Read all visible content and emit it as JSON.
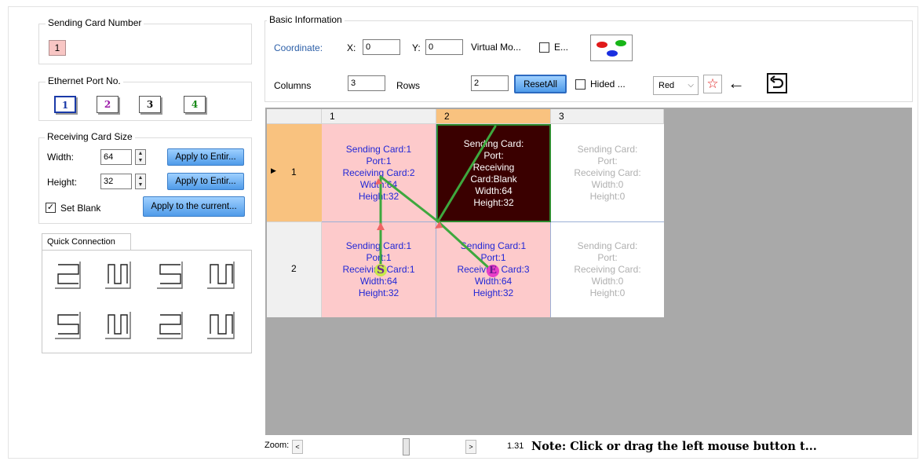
{
  "sending_card": {
    "title": "Sending Card Number",
    "value": "1"
  },
  "ethernet": {
    "title": "Ethernet Port No.",
    "ports": [
      "1",
      "2",
      "3",
      "4"
    ],
    "colors": [
      "#1a3aa8",
      "#9b1aa8",
      "#111111",
      "#1a8a1a"
    ]
  },
  "receiving_size": {
    "title": "Receiving Card Size",
    "width_label": "Width:",
    "width_value": "64",
    "height_label": "Height:",
    "height_value": "32",
    "apply_width": "Apply to Entir...",
    "apply_height": "Apply to Entir...",
    "set_blank": "Set Blank",
    "apply_current": "Apply to the current..."
  },
  "quick_connection": {
    "tab": "Quick Connection"
  },
  "basic_info": {
    "title": "Basic Information",
    "coordinate": "Coordinate:",
    "x_label": "X:",
    "x_value": "0",
    "y_label": "Y:",
    "y_value": "0",
    "virtual_mode": "Virtual Mo...",
    "e_label": "E...",
    "columns_label": "Columns",
    "columns_value": "3",
    "rows_label": "Rows",
    "rows_value": "2",
    "reset_all": "ResetAll",
    "hided": "Hided ...",
    "color_select": "Red"
  },
  "grid": {
    "col_headers": [
      "1",
      "2",
      "3"
    ],
    "row_headers": [
      "1",
      "2"
    ],
    "cells": [
      [
        {
          "l1": "Sending Card:1",
          "l2": "Port:1",
          "l3": "Receiving Card:2",
          "l4": "Width:64",
          "l5": "Height:32"
        },
        {
          "l1": "Sending Card:",
          "l2": "Port:",
          "l3": "Receiving",
          "l3b": "Card:Blank",
          "l4": "Width:64",
          "l5": "Height:32"
        },
        {
          "l1": "Sending Card:",
          "l2": "Port:",
          "l3": "Receiving Card:",
          "l4": "Width:0",
          "l5": "Height:0"
        }
      ],
      [
        {
          "l1": "Sending Card:1",
          "l2": "Port:1",
          "l3": "Receiving Card:1",
          "l4": "Width:64",
          "l5": "Height:32"
        },
        {
          "l1": "Sending Card:1",
          "l2": "Port:1",
          "l3": "Receiving Card:3",
          "l4": "Width:64",
          "l5": "Height:32"
        },
        {
          "l1": "Sending Card:",
          "l2": "Port:",
          "l3": "Receiving Card:",
          "l4": "Width:0",
          "l5": "Height:0"
        }
      ]
    ],
    "start_marker": "S",
    "end_marker": "E"
  },
  "footer": {
    "zoom_label": "Zoom:",
    "zoom_left": "<",
    "zoom_right": ">",
    "zoom_value": "1.31",
    "note": "Note: Click or drag the left mouse button t..."
  }
}
